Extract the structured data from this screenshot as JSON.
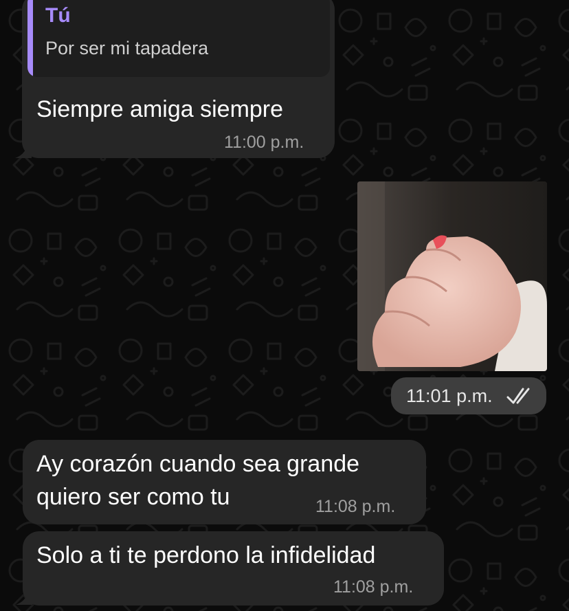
{
  "messages": [
    {
      "reply": {
        "author": "Tú",
        "text": "Por ser mi tapadera"
      },
      "text": "Siempre amiga siempre",
      "time": "11:00 p.m."
    },
    {
      "media": "photo",
      "time": "11:01 p.m.",
      "status_icon": "double-check-icon"
    },
    {
      "lines": [
        "Ay corazón cuando sea grande",
        "quiero ser como tu"
      ],
      "time": "11:08 p.m."
    },
    {
      "text": "Solo a ti te perdono la infidelidad",
      "time": "11:08 p.m."
    }
  ],
  "colors": {
    "background": "#0b0b0b",
    "incoming_bubble": "#262626",
    "quote_accent": "#a78bfa",
    "time_pill": "#3e3e3e"
  }
}
